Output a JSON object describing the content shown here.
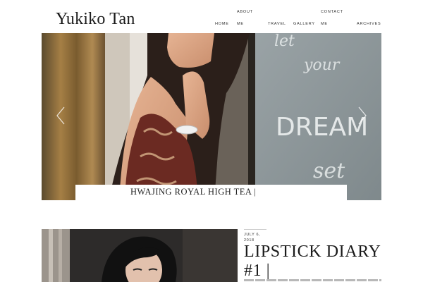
{
  "site": {
    "title": "Yukiko Tan"
  },
  "nav": {
    "home": "HOME",
    "about_line1": "ABOUT",
    "about_line2": "ME",
    "travel": "TRAVEL",
    "gallery": "GALLERY",
    "contact_line1": "CONTACT",
    "contact_line2": "ME",
    "archives": "ARCHIVES"
  },
  "hero": {
    "caption": "HWAJING ROYAL HIGH TEA |",
    "background_writing": [
      "let",
      "your",
      "DREAM",
      "set"
    ]
  },
  "post": {
    "date_line1": "JULY 6,",
    "date_line2": "2018",
    "title_line1": "LIPSTICK DIARY",
    "title_line2": "#1 |"
  },
  "icons": {
    "prev": "chevron-left-icon",
    "next": "chevron-right-icon"
  }
}
